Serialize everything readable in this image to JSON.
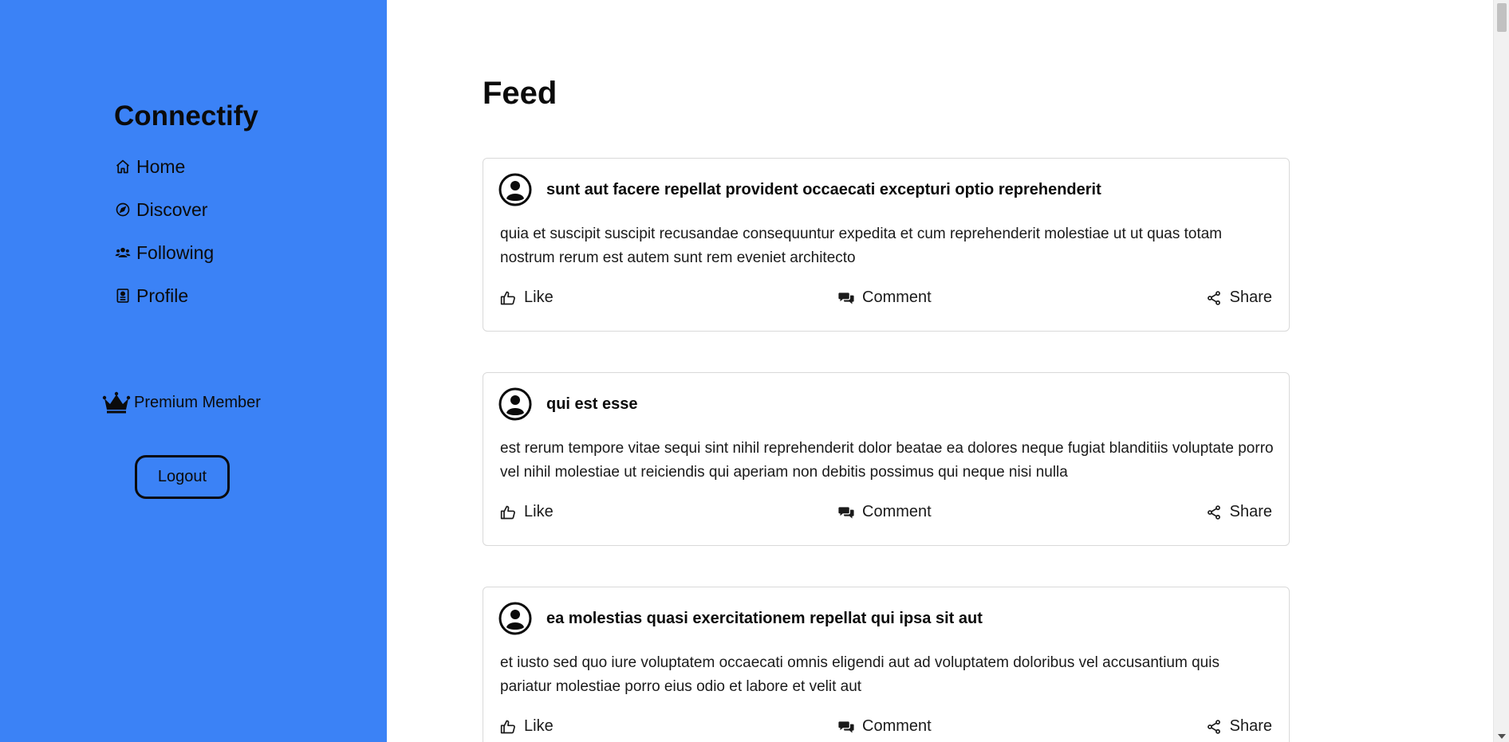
{
  "sidebar": {
    "brand": "Connectify",
    "nav": [
      {
        "label": "Home",
        "icon": "home-icon"
      },
      {
        "label": "Discover",
        "icon": "compass-icon"
      },
      {
        "label": "Following",
        "icon": "users-icon"
      },
      {
        "label": "Profile",
        "icon": "profile-card-icon"
      }
    ],
    "premium_label": "Premium Member",
    "premium_icon": "crown-icon",
    "logout_label": "Logout",
    "background_color": "#3b82f6"
  },
  "main": {
    "title": "Feed",
    "posts": [
      {
        "title": "sunt aut facere repellat provident occaecati excepturi optio reprehenderit",
        "body": "quia et suscipit suscipit recusandae consequuntur expedita et cum reprehenderit molestiae ut ut quas totam nostrum rerum est autem sunt rem eveniet architecto",
        "like_label": "Like",
        "comment_label": "Comment",
        "share_label": "Share"
      },
      {
        "title": "qui est esse",
        "body": "est rerum tempore vitae sequi sint nihil reprehenderit dolor beatae ea dolores neque fugiat blanditiis voluptate porro vel nihil molestiae ut reiciendis qui aperiam non debitis possimus qui neque nisi nulla",
        "like_label": "Like",
        "comment_label": "Comment",
        "share_label": "Share"
      },
      {
        "title": "ea molestias quasi exercitationem repellat qui ipsa sit aut",
        "body": "et iusto sed quo iure voluptatem occaecati omnis eligendi aut ad voluptatem doloribus vel accusantium quis pariatur molestiae porro eius odio et labore et velit aut",
        "like_label": "Like",
        "comment_label": "Comment",
        "share_label": "Share"
      }
    ]
  }
}
